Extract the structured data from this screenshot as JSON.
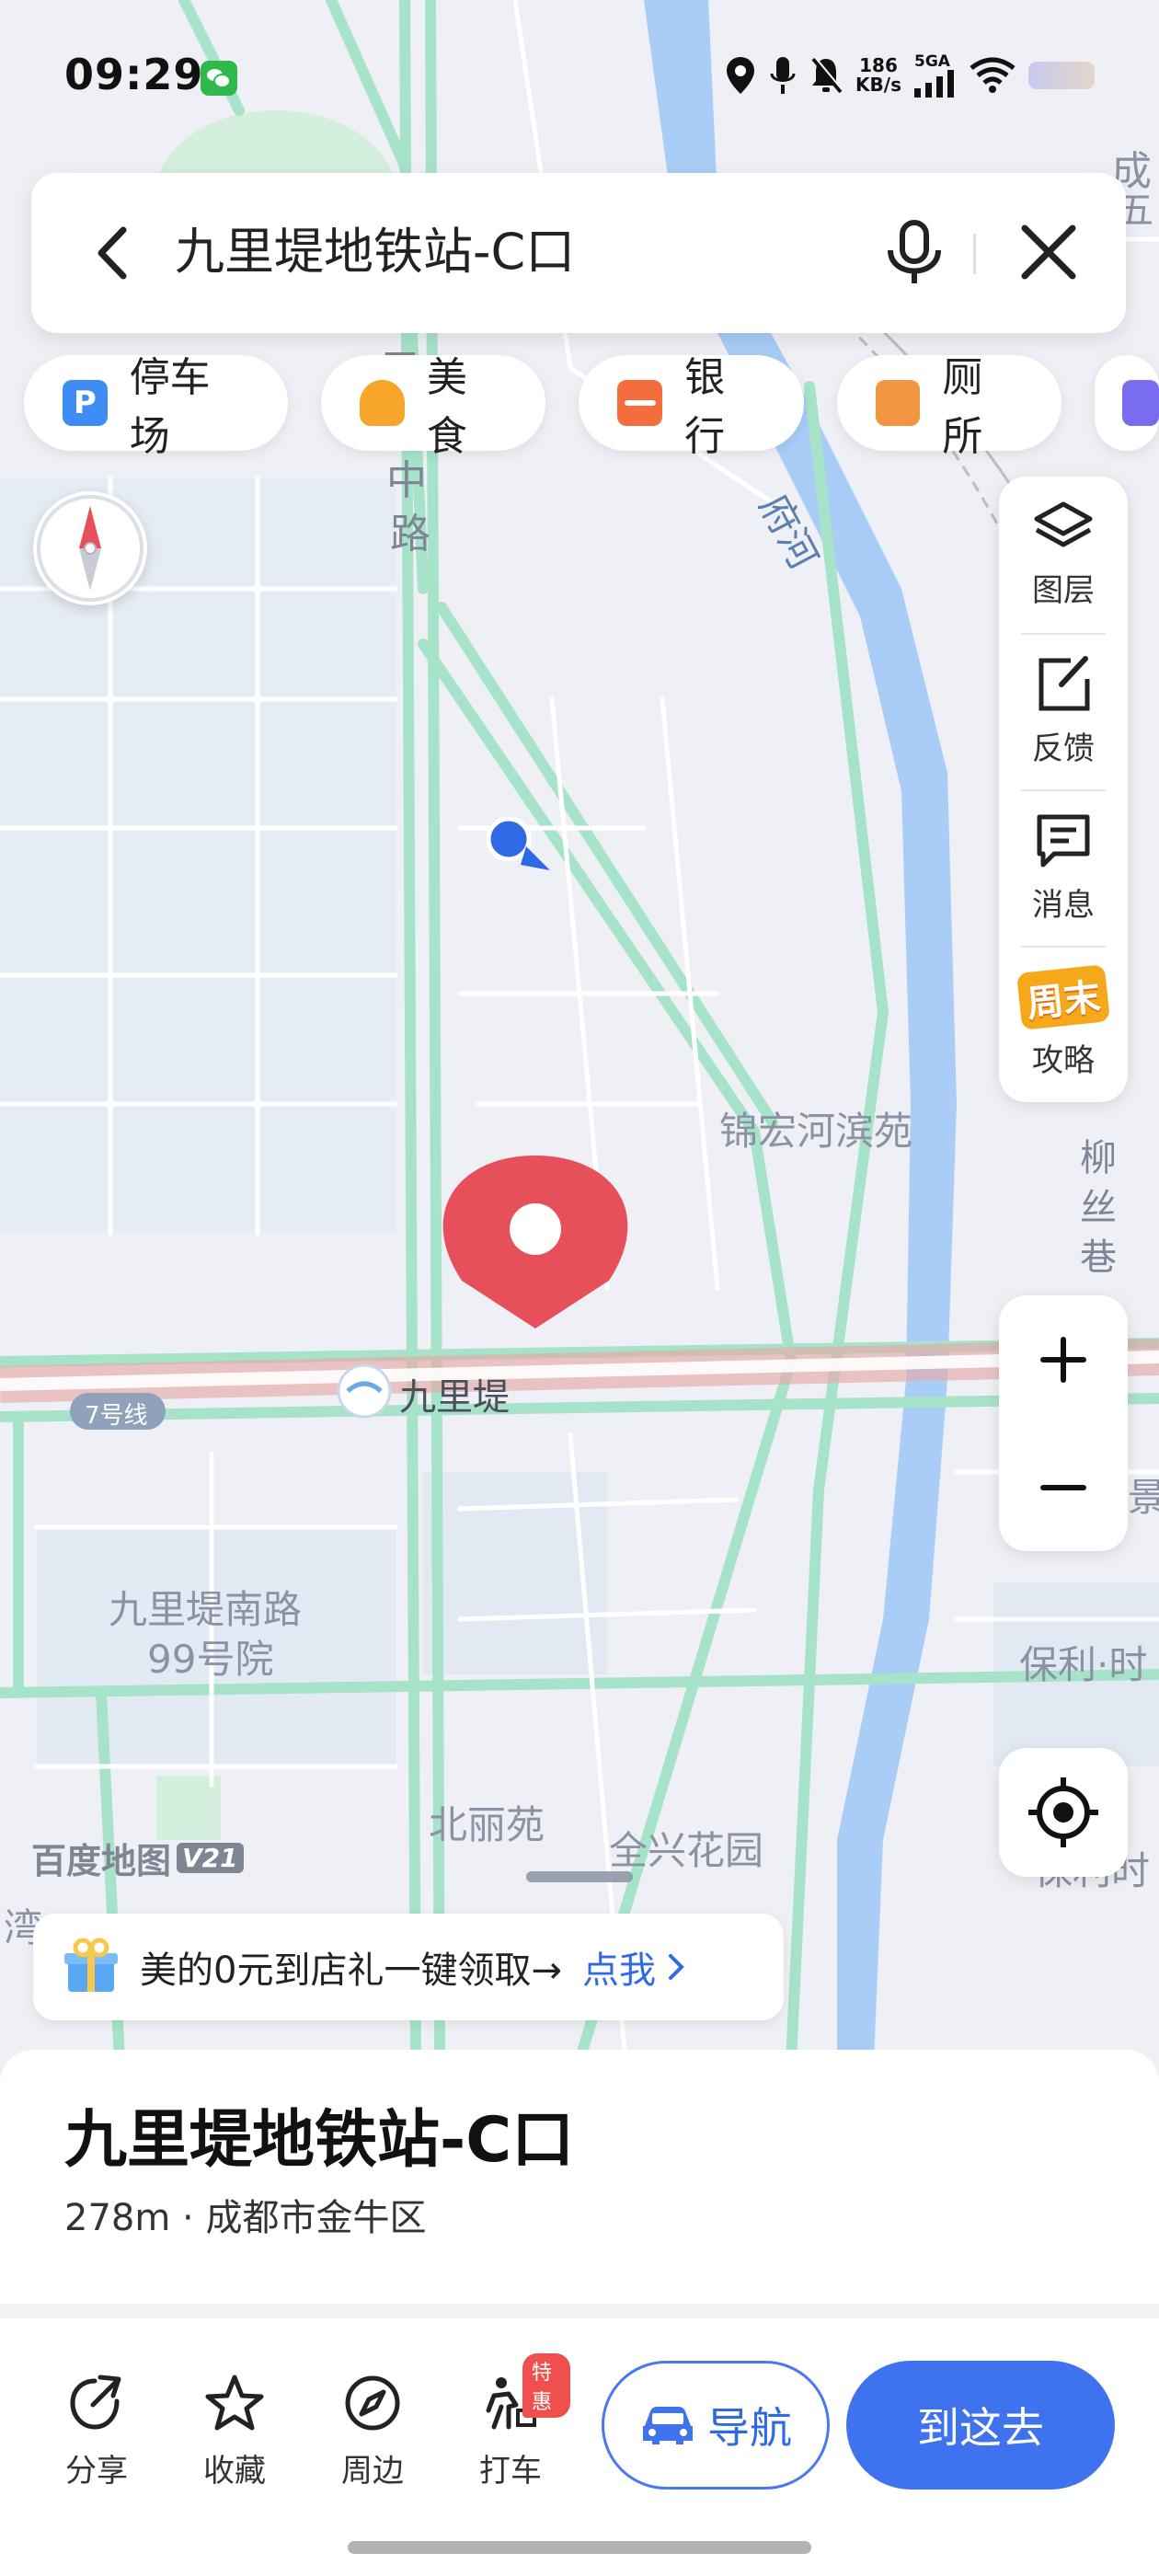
{
  "status_bar": {
    "time": "09:29",
    "speed_value": "186",
    "speed_unit": "KB/s",
    "network": "5GA"
  },
  "search": {
    "query": "九里堤地铁站-C口"
  },
  "chips": [
    {
      "icon": "parking-icon",
      "label": "停车场",
      "color": "#3d8df5"
    },
    {
      "icon": "food-icon",
      "label": "美食",
      "color": "#f7a62b"
    },
    {
      "icon": "bank-icon",
      "label": "银行",
      "color": "#f36e3c"
    },
    {
      "icon": "toilet-icon",
      "label": "厕所",
      "color": "#f29543"
    }
  ],
  "tools": {
    "layers": "图层",
    "feedback": "反馈",
    "messages": "消息",
    "weekend_badge": "周末",
    "guide": "攻略"
  },
  "map_labels": {
    "road_west_a": "中",
    "road_west_b": "路",
    "road_west_top": "用",
    "river": "府河",
    "estate_1": "锦宏河滨苑",
    "alley_1": "柳",
    "alley_2": "丝",
    "alley_3": "巷",
    "metro_line": "7号线",
    "station": "九里堤",
    "compound_1": "九里堤南路",
    "compound_2": "99号院",
    "estate_2": "北丽苑",
    "estate_3": "全兴花园",
    "edge_right_1": "保利·时",
    "edge_right_2": "保利时",
    "edge_right_3": "景",
    "edge_left_1": "湾",
    "edge_top_right_1": "成",
    "edge_top_right_2": "五"
  },
  "brand": {
    "name": "百度地图",
    "version": "V21"
  },
  "promo": {
    "text": "美的0元到店礼一键领取→",
    "link": "点我"
  },
  "place": {
    "name": "九里堤地铁站-C口",
    "detail": "278m · 成都市金牛区"
  },
  "actions": {
    "share": "分享",
    "favorite": "收藏",
    "nearby": "周边",
    "taxi": "打车",
    "taxi_badge": "特惠"
  },
  "navigate_label": "导航",
  "go_label": "到这去",
  "colors": {
    "accent": "#3f72ef",
    "marker": "#e5505a",
    "water": "#a9cdf6",
    "road": "#a7e3c8",
    "metro": "#e6a6a6"
  }
}
